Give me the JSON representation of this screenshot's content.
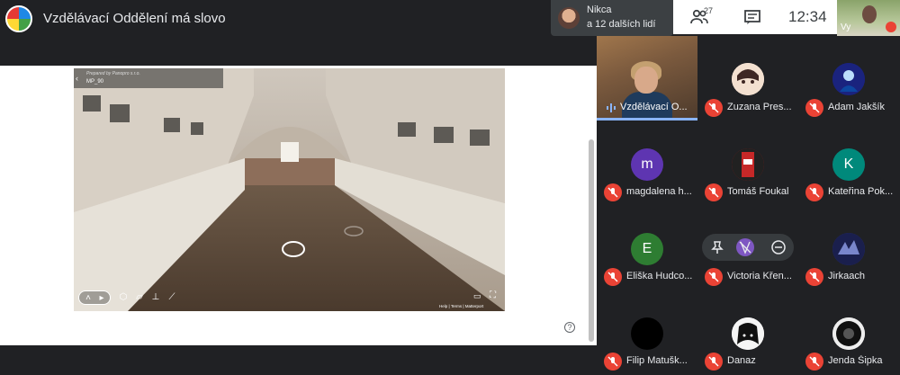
{
  "header": {
    "meeting_title": "Vzdělávací Oddělení má slovo",
    "participants_chip": {
      "line1": "Nikca",
      "line2": "a 12 dalších lidí"
    },
    "people_count": "27",
    "clock": "12:34",
    "self_label": "Vy"
  },
  "presentation": {
    "tour_credit": "Prepared by Panopro s.r.o.",
    "tour_name": "MP_90",
    "tour_footer": "Help  |  Terms  |  Matterport",
    "help_glyph": "?"
  },
  "participants": [
    {
      "name": "Vzdělávací O...",
      "speaking": true
    },
    {
      "name": "Zuzana Pres...",
      "avatar_color": "#f3e0d0"
    },
    {
      "name": "Adam Jakšík",
      "avatar_color": "#1a237e"
    },
    {
      "name": "magdalena h...",
      "initial": "m",
      "avatar_color": "#5e35b1"
    },
    {
      "name": "Tomáš Foukal",
      "avatar_color": "#b71c1c"
    },
    {
      "name": "Kateřina Pok...",
      "initial": "K",
      "avatar_color": "#00897b"
    },
    {
      "name": "Eliška Hudco...",
      "initial": "E",
      "avatar_color": "#2e7d32"
    },
    {
      "name": "Victoria Křen...",
      "avatar_color": "#5c4a8a"
    },
    {
      "name": "Jirkaach",
      "avatar_color": "#283593"
    },
    {
      "name": "Filip Matušk...",
      "avatar_color": "#000000"
    },
    {
      "name": "Danaz",
      "avatar_color": "#101010"
    },
    {
      "name": "Jenda Šipka",
      "avatar_color": "#eeeeee"
    }
  ],
  "colors": {
    "muted_badge": "#ea4335",
    "active_border": "#8ab4f8",
    "background": "#202124"
  }
}
